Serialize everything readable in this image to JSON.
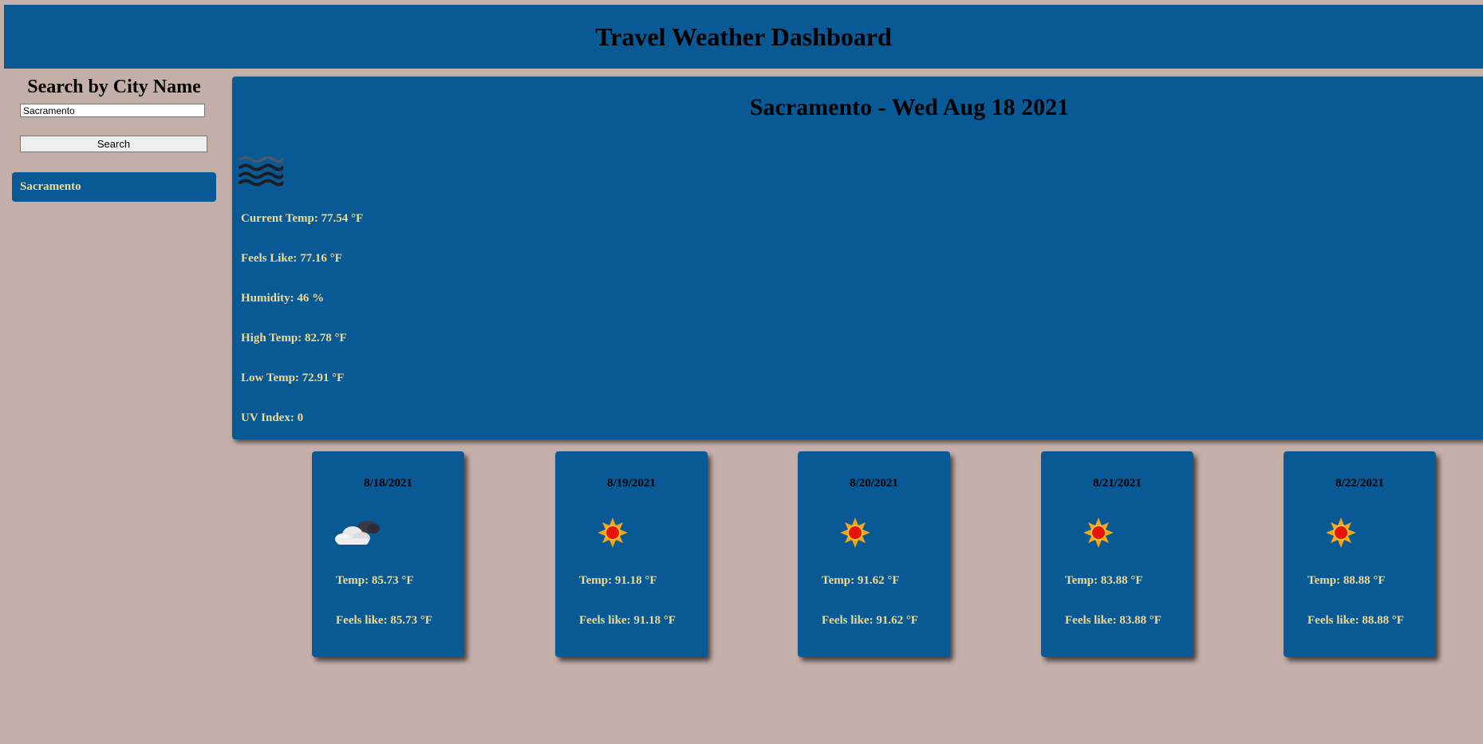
{
  "header": {
    "title": "Travel Weather Dashboard"
  },
  "sidebar": {
    "heading": "Search by City Name",
    "search_value": "Sacramento",
    "search_button": "Search",
    "history": [
      "Sacramento"
    ]
  },
  "current": {
    "title": "Sacramento - Wed Aug 18 2021",
    "icon": "mist-icon",
    "current_temp": "Current Temp: 77.54 °F",
    "feels_like": "Feels Like: 77.16 °F",
    "humidity": "Humidity: 46 %",
    "high_temp": "High Temp: 82.78 °F",
    "low_temp": "Low Temp: 72.91 °F",
    "uv_index": "UV Index: 0"
  },
  "forecast": [
    {
      "date": "8/18/2021",
      "icon": "partly-cloudy-icon",
      "temp": "Temp: 85.73 °F",
      "feels": "Feels like: 85.73 °F"
    },
    {
      "date": "8/19/2021",
      "icon": "sun-icon",
      "temp": "Temp: 91.18 °F",
      "feels": "Feels like: 91.18 °F"
    },
    {
      "date": "8/20/2021",
      "icon": "sun-icon",
      "temp": "Temp: 91.62 °F",
      "feels": "Feels like: 91.62 °F"
    },
    {
      "date": "8/21/2021",
      "icon": "sun-icon",
      "temp": "Temp: 83.88 °F",
      "feels": "Feels like: 83.88 °F"
    },
    {
      "date": "8/22/2021",
      "icon": "sun-icon",
      "temp": "Temp: 88.88 °F",
      "feels": "Feels like: 88.88 °F"
    }
  ],
  "colors": {
    "background": "#c4afa8",
    "panel": "#095994",
    "accent_text": "#f3d98a"
  }
}
